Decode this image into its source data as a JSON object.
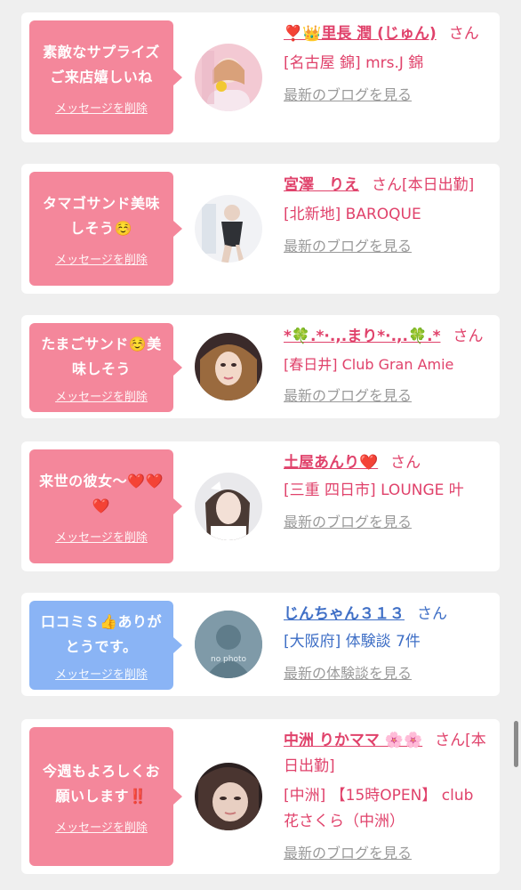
{
  "entries": [
    {
      "message": "素敵なサプライズご来店嬉しいね",
      "delete_label": "メッセージを削除",
      "name": "❣️👑里長 潤 (じゅん)",
      "honorific": "さん",
      "status": "",
      "shop": "[名古屋 錦] mrs.J 錦",
      "link": "最新のブログを見る"
    },
    {
      "message": "タマゴサンド美味しそう☺️",
      "delete_label": "メッセージを削除",
      "name": "宮澤　りえ",
      "honorific": "さん",
      "status": "[本日出勤]",
      "shop": "[北新地] BAROQUE",
      "link": "最新のブログを見る"
    },
    {
      "message": "たまごサンド☺️美味しそう",
      "delete_label": "メッセージを削除",
      "name": "*🍀.*·.,.まり*·.,.🍀.*",
      "honorific": "さん",
      "status": "",
      "shop": "[春日井] Club Gran Amie",
      "link": "最新のブログを見る"
    },
    {
      "message": "来世の彼女〜❤️❤️❤️",
      "delete_label": "メッセージを削除",
      "name": "土屋あんり❤️",
      "honorific": "さん",
      "status": "",
      "shop": "[三重 四日市] LOUNGE 叶",
      "link": "最新のブログを見る"
    },
    {
      "message": "口コミＳ👍ありがとうです。",
      "delete_label": "メッセージを削除",
      "name": "じんちゃん３１３",
      "honorific": "さん",
      "status": "",
      "shop": "[大阪府] 体験談 7件",
      "link": "最新の体験談を見る",
      "avatar_text": "no photo"
    },
    {
      "message": "今週もよろしくお願いします‼️",
      "delete_label": "メッセージを削除",
      "name": "中洲 りかママ 🌸🌸",
      "honorific": "さん",
      "status": "[本日出勤]",
      "shop": "[中洲] 【15時OPEN】 club 花さくら（中洲）",
      "link": "最新のブログを見る"
    }
  ],
  "colors": {
    "pink_bubble": "#f4879b",
    "blue_bubble": "#8ab4f5",
    "pink_text": "#e0426b",
    "blue_text": "#3f6fc6",
    "link_gray": "#9a9a9a"
  }
}
